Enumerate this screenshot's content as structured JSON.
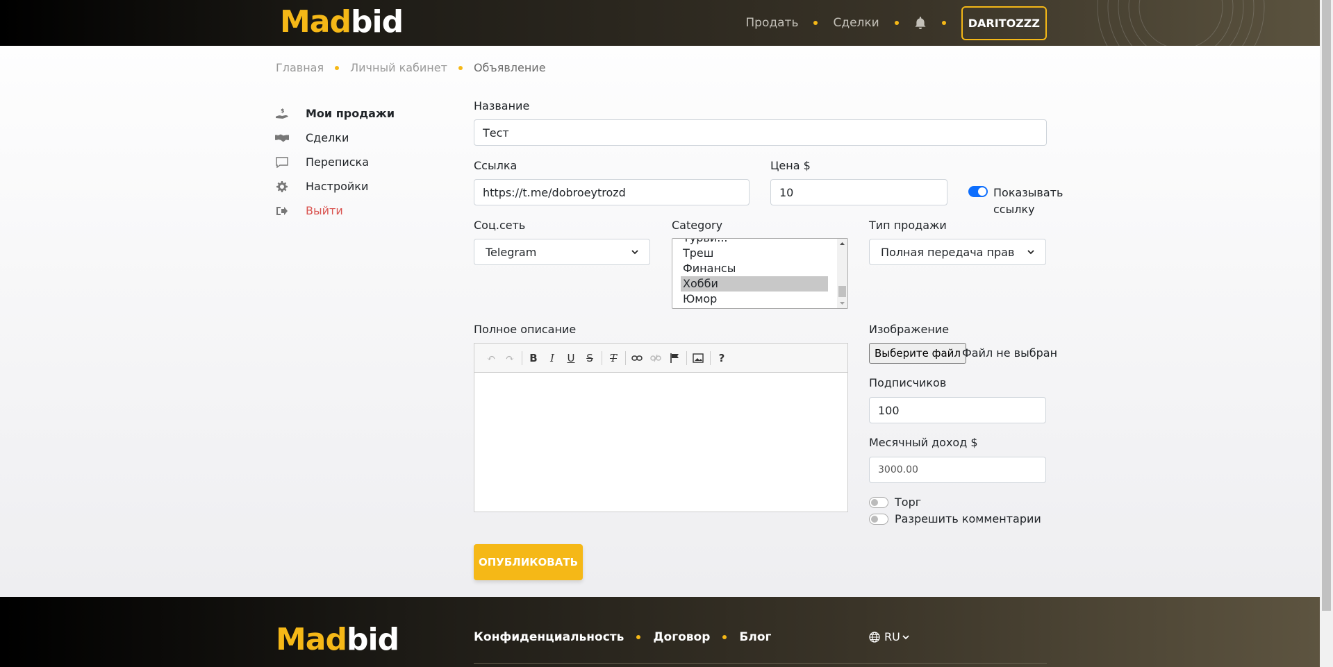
{
  "header": {
    "logo_mad": "Mad",
    "logo_bid": "bid",
    "nav": {
      "sell": "Продать",
      "deals": "Сделки"
    },
    "user": "DARITOZZZ"
  },
  "breadcrumb": {
    "home": "Главная",
    "cabinet": "Личный кабинет",
    "current": "Объявление"
  },
  "sidebar": {
    "items": [
      {
        "label": "Мои продажи",
        "icon": "hand-money-icon"
      },
      {
        "label": "Сделки",
        "icon": "handshake-icon"
      },
      {
        "label": "Переписка",
        "icon": "chat-icon"
      },
      {
        "label": "Настройки",
        "icon": "gear-icon"
      },
      {
        "label": "Выйти",
        "icon": "logout-icon"
      }
    ]
  },
  "form": {
    "name_label": "Название",
    "name_value": "Тест",
    "link_label": "Ссылка",
    "link_value": "https://t.me/dobroeytrozd",
    "price_label": "Цена $",
    "price_value": "10",
    "show_link_label_1": "Показывать",
    "show_link_label_2": "ссылку",
    "social_label": "Соц.сеть",
    "social_value": "Telegram",
    "category_label": "Category",
    "category_options": [
      "Турьи...",
      "Треш",
      "Финансы",
      "Хобби",
      "Юмор"
    ],
    "sale_type_label": "Тип продажи",
    "sale_type_value": "Полная передача прав",
    "description_label": "Полное описание",
    "image_label": "Изображение",
    "file_button": "Выберите файл",
    "file_status": "Файл не выбран",
    "subscribers_label": "Подписчиков",
    "subscribers_value": "100",
    "income_label": "Месячный доход $",
    "income_placeholder": "3000.00",
    "bargain_label": "Торг",
    "comments_label": "Разрешить комментарии",
    "publish_button": "ОПУБЛИКОВАТЬ"
  },
  "footer": {
    "links": [
      "Конфиденциальность",
      "Договор",
      "Блог"
    ],
    "lang": "RU"
  },
  "colors": {
    "accent": "#f5b817",
    "toggle_on": "#0d6efd",
    "logout": "#d9534f"
  }
}
